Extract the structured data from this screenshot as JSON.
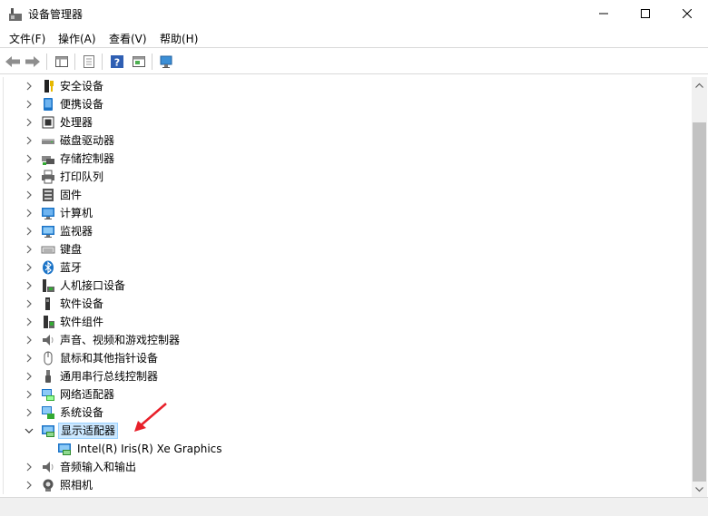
{
  "window": {
    "title": "设备管理器"
  },
  "menu": [
    {
      "label": "文件(F)"
    },
    {
      "label": "操作(A)"
    },
    {
      "label": "查看(V)"
    },
    {
      "label": "帮助(H)"
    }
  ],
  "tree": [
    {
      "label": "安全设备",
      "icon": "security-device-icon"
    },
    {
      "label": "便携设备",
      "icon": "portable-device-icon"
    },
    {
      "label": "处理器",
      "icon": "processor-icon"
    },
    {
      "label": "磁盘驱动器",
      "icon": "disk-drive-icon"
    },
    {
      "label": "存储控制器",
      "icon": "storage-controller-icon"
    },
    {
      "label": "打印队列",
      "icon": "printer-icon"
    },
    {
      "label": "固件",
      "icon": "firmware-icon"
    },
    {
      "label": "计算机",
      "icon": "computer-icon"
    },
    {
      "label": "监视器",
      "icon": "monitor-icon"
    },
    {
      "label": "键盘",
      "icon": "keyboard-icon"
    },
    {
      "label": "蓝牙",
      "icon": "bluetooth-icon"
    },
    {
      "label": "人机接口设备",
      "icon": "hid-icon"
    },
    {
      "label": "软件设备",
      "icon": "software-device-icon"
    },
    {
      "label": "软件组件",
      "icon": "software-component-icon"
    },
    {
      "label": "声音、视频和游戏控制器",
      "icon": "sound-icon"
    },
    {
      "label": "鼠标和其他指针设备",
      "icon": "mouse-icon"
    },
    {
      "label": "通用串行总线控制器",
      "icon": "usb-icon"
    },
    {
      "label": "网络适配器",
      "icon": "network-adapter-icon"
    },
    {
      "label": "系统设备",
      "icon": "system-device-icon"
    },
    {
      "label": "显示适配器",
      "icon": "display-adapter-icon",
      "expanded": true,
      "selected": true
    },
    {
      "label": "Intel(R) Iris(R) Xe Graphics",
      "icon": "display-adapter-icon",
      "child": true
    },
    {
      "label": "音频输入和输出",
      "icon": "audio-io-icon"
    },
    {
      "label": "照相机",
      "icon": "camera-icon"
    }
  ],
  "colors": {
    "selection_bg": "#cce8ff",
    "selection_border": "#99d1ff",
    "annotation_arrow": "#e8202a"
  }
}
